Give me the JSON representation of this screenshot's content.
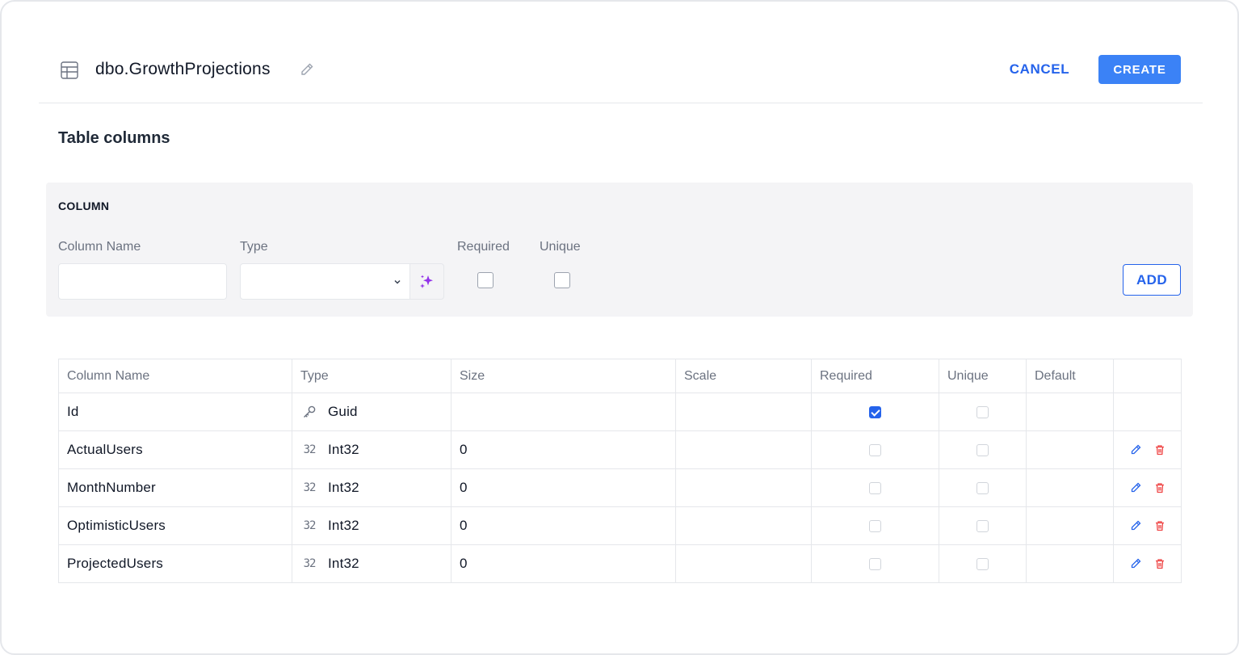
{
  "header": {
    "table_icon": "table-grid-icon",
    "title": "dbo.GrowthProjections",
    "edit_icon": "pencil-icon",
    "cancel_label": "CANCEL",
    "create_label": "CREATE"
  },
  "section_title": "Table columns",
  "form": {
    "heading": "COLUMN",
    "column_name_label": "Column Name",
    "column_name_value": "",
    "type_label": "Type",
    "type_value": "",
    "required_label": "Required",
    "required_checked": false,
    "unique_label": "Unique",
    "unique_checked": false,
    "add_label": "ADD",
    "ai_icon": "sparkles-icon"
  },
  "table": {
    "headers": [
      "Column Name",
      "Type",
      "Size",
      "Scale",
      "Required",
      "Unique",
      "Default",
      ""
    ],
    "rows": [
      {
        "name": "Id",
        "type_icon": "key-icon",
        "type": "Guid",
        "size": "",
        "scale": "",
        "required": true,
        "unique": false,
        "default": "",
        "actions": false
      },
      {
        "name": "ActualUsers",
        "type_icon": "number-32-icon",
        "type": "Int32",
        "size": "0",
        "scale": "",
        "required": false,
        "unique": false,
        "default": "",
        "actions": true
      },
      {
        "name": "MonthNumber",
        "type_icon": "number-32-icon",
        "type": "Int32",
        "size": "0",
        "scale": "",
        "required": false,
        "unique": false,
        "default": "",
        "actions": true
      },
      {
        "name": "OptimisticUsers",
        "type_icon": "number-32-icon",
        "type": "Int32",
        "size": "0",
        "scale": "",
        "required": false,
        "unique": false,
        "default": "",
        "actions": true
      },
      {
        "name": "ProjectedUsers",
        "type_icon": "number-32-icon",
        "type": "Int32",
        "size": "0",
        "scale": "",
        "required": false,
        "unique": false,
        "default": "",
        "actions": true
      }
    ],
    "int_icon_glyph": "32"
  },
  "colors": {
    "accent": "#2563eb",
    "create_bg": "#3b82f6",
    "panel_bg": "#f4f4f6",
    "delete": "#ef4444",
    "sparkle": "#9333ea"
  }
}
